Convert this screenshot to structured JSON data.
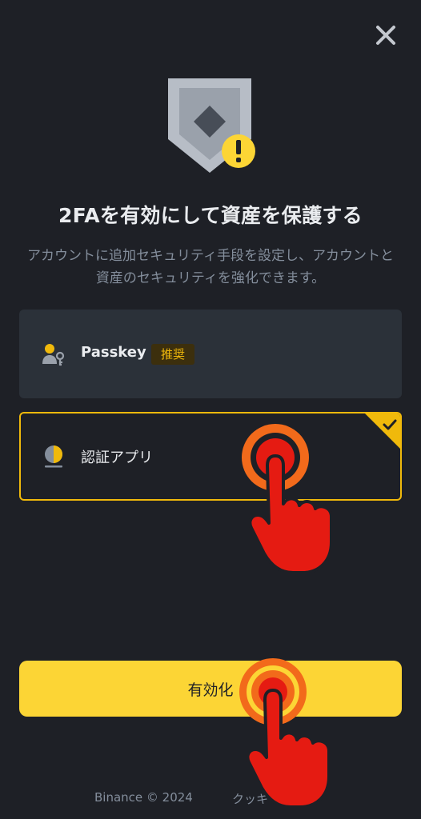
{
  "header": {
    "close_icon": "close-icon"
  },
  "hero": {
    "icon": "shield-warning-icon",
    "colors": {
      "shield": "#b7bdc6",
      "warning": "#fcd535"
    }
  },
  "title": "2FAを有効にして資産を保護する",
  "subtitle": "アカウントに追加セキュリティ手段を設定し、アカウントと資産のセキュリティを強化できます。",
  "options": [
    {
      "label": "Passkey",
      "badge": "推奨",
      "icon": "passkey-user-key-icon",
      "selected": false
    },
    {
      "label": "認証アプリ",
      "icon": "authenticator-app-icon",
      "selected": true
    }
  ],
  "primary_button": {
    "label": "有効化"
  },
  "footer": {
    "copyright": "Binance © 2024",
    "cookie_link": "クッキーの設定"
  },
  "annotations": [
    {
      "icon": "tap-hand-icon",
      "target": "認証アプリ"
    },
    {
      "icon": "tap-hand-icon",
      "target": "有効化"
    }
  ],
  "colors": {
    "background": "#1e2026",
    "card": "#2b3139",
    "accent": "#fcd535",
    "selected_border": "#f0b90b",
    "muted_text": "#848e9c",
    "annotation_red": "#e51b12",
    "annotation_orange": "#f26a1b"
  }
}
